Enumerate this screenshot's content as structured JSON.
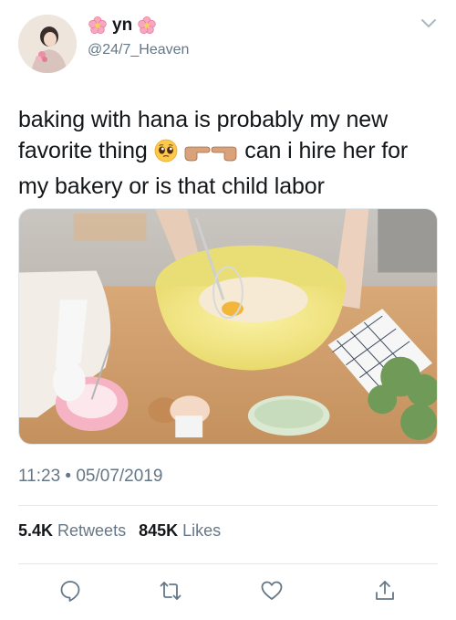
{
  "user": {
    "display_name": "yn",
    "handle": "@24/7_Heaven",
    "name_decoration_icon": "cherry-blossom-icon"
  },
  "tweet": {
    "text_part1": "baking with hana is probably my new favorite thing ",
    "text_part2": " can i hire her for my bakery or is that child labor",
    "emojis": [
      "pleading-face-icon",
      "backhand-index-pointing-right-icon",
      "backhand-index-pointing-left-icon"
    ],
    "timestamp": "11:23 • 05/07/2019"
  },
  "stats": {
    "retweets_count": "5.4K",
    "retweets_label": "Retweets",
    "likes_count": "845K",
    "likes_label": "Likes"
  },
  "actions": {
    "reply_icon": "reply-icon",
    "retweet_icon": "retweet-icon",
    "like_icon": "heart-icon",
    "share_icon": "share-icon"
  },
  "colors": {
    "text_primary": "#14171a",
    "text_secondary": "#657786",
    "divider": "#e1e8ed"
  }
}
